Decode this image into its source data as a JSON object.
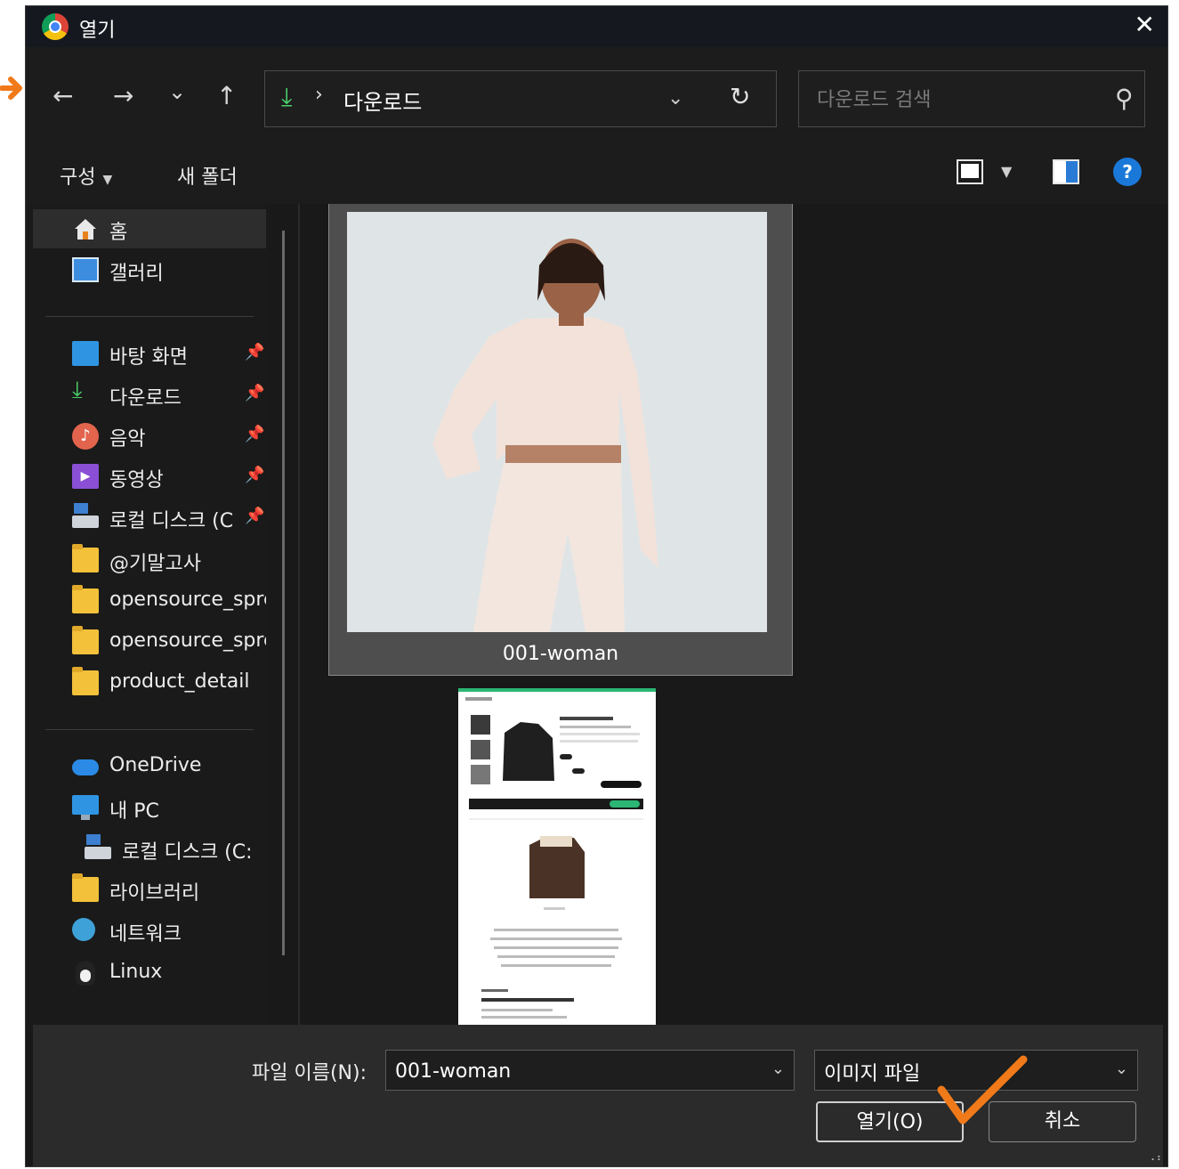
{
  "window": {
    "title": "열기"
  },
  "nav": {
    "back": "←",
    "forward": "→",
    "recent": "⌄",
    "up": "↑",
    "address_location": "다운로드",
    "search_placeholder": "다운로드 검색"
  },
  "toolbar": {
    "organize_label": "구성",
    "new_folder_label": "새 폴더",
    "help_label": "?"
  },
  "sidebar": {
    "top": [
      {
        "label": "홈",
        "icon": "home-icon",
        "selected": true
      },
      {
        "label": "갤러리",
        "icon": "gallery-icon"
      }
    ],
    "pinned": [
      {
        "label": "바탕 화면",
        "icon": "desktop-folder-icon"
      },
      {
        "label": "다운로드",
        "icon": "download-icon"
      },
      {
        "label": "음악",
        "icon": "music-icon"
      },
      {
        "label": "동영상",
        "icon": "video-icon"
      },
      {
        "label": "로컬 디스크 (C",
        "icon": "local-disk-icon"
      },
      {
        "label": "@기말고사",
        "icon": "folder-icon"
      },
      {
        "label": "opensource_sprea",
        "icon": "folder-icon"
      },
      {
        "label": "opensource_sprea",
        "icon": "folder-icon"
      },
      {
        "label": "product_detail",
        "icon": "folder-icon"
      }
    ],
    "locations": [
      {
        "label": "OneDrive",
        "icon": "onedrive-icon"
      },
      {
        "label": "내 PC",
        "icon": "this-pc-icon"
      },
      {
        "label": "로컬 디스크 (C:",
        "icon": "local-disk-icon"
      },
      {
        "label": "라이브러리",
        "icon": "folder-icon"
      },
      {
        "label": "네트워크",
        "icon": "network-icon"
      },
      {
        "label": "Linux",
        "icon": "linux-icon"
      }
    ]
  },
  "files": [
    {
      "name": "001-woman",
      "selected": true
    },
    {
      "name": "",
      "selected": false
    }
  ],
  "footer": {
    "filename_label": "파일 이름(N):",
    "filename_value": "001-woman",
    "filetype_value": "이미지 파일",
    "open_label": "열기(O)",
    "cancel_label": "취소"
  },
  "colors": {
    "accent_green": "#4cd06a",
    "annotation_orange": "#f07a1a",
    "help_blue": "#1a78d8"
  }
}
